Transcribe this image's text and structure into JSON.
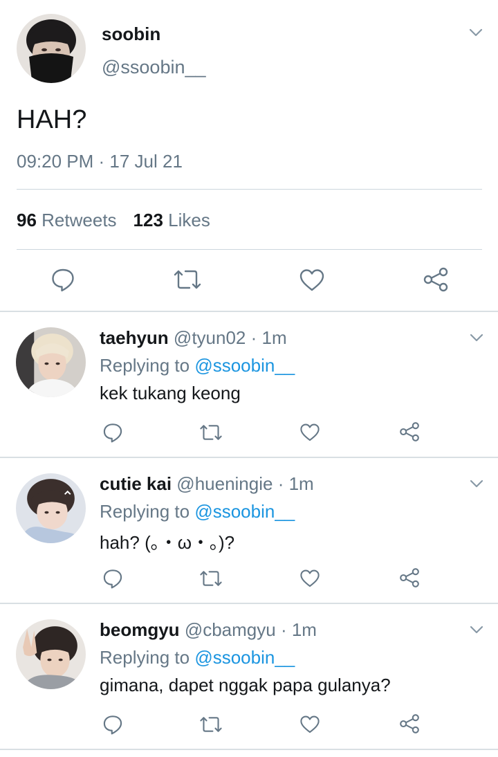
{
  "tweet": {
    "author_name": "soobin",
    "author_handle": "@ssoobin__",
    "text": "HAH?",
    "time": "09:20 PM",
    "date": "17 Jul 21",
    "retweets_count": "96",
    "retweets_label": "Retweets",
    "likes_count": "123",
    "likes_label": "Likes"
  },
  "replies": [
    {
      "name": "taehyun",
      "handle": "@tyun02",
      "time": "1m",
      "replying_prefix": "Replying to",
      "replying_to": "@ssoobin__",
      "text": "kek tukang keong"
    },
    {
      "name": "cutie kai",
      "handle": "@hueningie",
      "time": "1m",
      "replying_prefix": "Replying to",
      "replying_to": "@ssoobin__",
      "text": "hah? (｡・ω・｡)?"
    },
    {
      "name": "beomgyu",
      "handle": "@cbamgyu",
      "time": "1m",
      "replying_prefix": "Replying to",
      "replying_to": "@ssoobin__",
      "text": "gimana, dapet nggak papa gulanya?"
    }
  ],
  "icons": [
    "reply-icon",
    "retweet-icon",
    "like-icon",
    "share-icon",
    "chevron-down-icon"
  ],
  "colors": {
    "text_primary": "#14171a",
    "text_secondary": "#657786",
    "link": "#1b95e0",
    "divider": "#ccd6dd"
  }
}
